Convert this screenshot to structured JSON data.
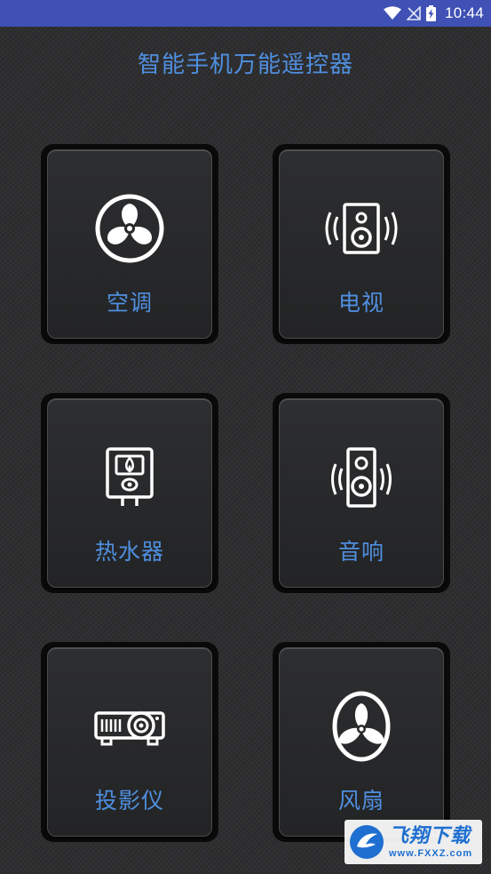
{
  "status_bar": {
    "time": "10:44",
    "icons": [
      "wifi-icon",
      "no-signal-icon",
      "battery-charging-icon"
    ],
    "background": "#3f51b5"
  },
  "app": {
    "title": "智能手机万能遥控器",
    "accent_color": "#4f8fe0"
  },
  "devices": [
    {
      "label": "空调",
      "icon": "fan-icon"
    },
    {
      "label": "电视",
      "icon": "speaker-waves-icon"
    },
    {
      "label": "热水器",
      "icon": "water-heater-icon"
    },
    {
      "label": "音响",
      "icon": "tall-speaker-icon"
    },
    {
      "label": "投影仪",
      "icon": "projector-icon"
    },
    {
      "label": "风扇",
      "icon": "fan-oval-icon"
    }
  ],
  "watermark": {
    "name": "飞翔下载",
    "url": "www.FXXZ.com"
  }
}
